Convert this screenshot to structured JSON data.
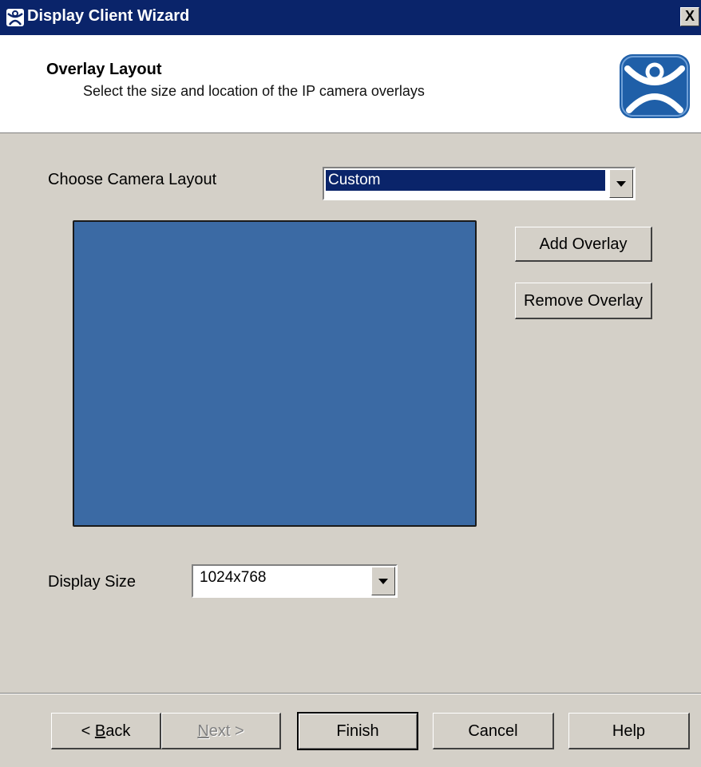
{
  "window": {
    "title": "Display Client Wizard",
    "close_label": "X"
  },
  "header": {
    "title": "Overlay Layout",
    "subtitle": "Select the size and location of the IP camera overlays"
  },
  "camera_layout": {
    "label": "Choose Camera Layout",
    "selected": "Custom"
  },
  "overlay_buttons": {
    "add": "Add Overlay",
    "remove": "Remove Overlay"
  },
  "display_size": {
    "label": "Display Size",
    "selected": "1024x768"
  },
  "footer": {
    "back": {
      "prefix": "< ",
      "mnemonic": "B",
      "rest": "ack"
    },
    "next": {
      "mnemonic": "N",
      "rest": "ext >"
    },
    "finish": "Finish",
    "cancel": "Cancel",
    "help": "Help"
  },
  "colors": {
    "titlebar": "#0a246a",
    "dialog": "#d4d0c8",
    "preview": "#3b6aa4",
    "logo": "#1f5fa8"
  },
  "icons": [
    "app-logo-icon",
    "close-icon",
    "dropdown-arrow-icon"
  ]
}
